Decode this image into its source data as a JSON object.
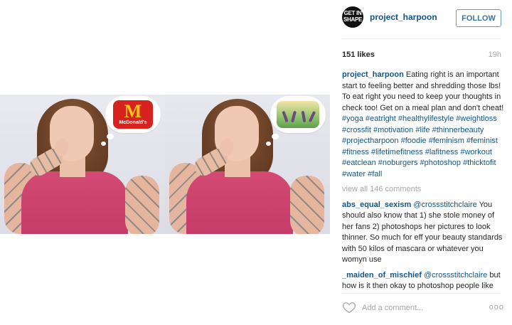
{
  "post": {
    "images": [
      {
        "thought": "McDonald's"
      },
      {
        "thought": "yoga-scene"
      }
    ],
    "header": {
      "avatar_text": "GET IN SHAPE",
      "username": "project_harpoon",
      "follow_label": "FOLLOW"
    },
    "stats": {
      "likes": "151 likes",
      "time": "19h"
    },
    "caption": {
      "username": "project_harpoon",
      "text": " Eating right is an important start to feeling better and shredding those lbs! To eat right you need to keep your thoughts in check too! Get on a meal plan and don't cheat! ",
      "hashtags": [
        "#yoga",
        "#eatright",
        "#healthylifestyle",
        "#weightloss",
        "#crossfit",
        "#motivation",
        "#life",
        "#thinnerbeauty",
        "#projectharpoon",
        "#foodie",
        "#feminism",
        "#feminist",
        "#fitness",
        "#lifetimefitness",
        "#lafitness",
        "#workout",
        "#eatclean",
        "#noburgers",
        "#photoshop",
        "#thicktofit",
        "#water",
        "#fall"
      ]
    },
    "view_all": "view all 146 comments",
    "comments": [
      {
        "username": "abs_equal_sexism",
        "mention": "@crossstitchclaire",
        "text": " You should also know that 1) she stole money of her fans 2) photoshops her pictures to look thinner. So much for eff your beauty standards with 50 kilos of mascara or whatever you womyn use"
      },
      {
        "username": "_maiden_of_mischief",
        "mention": "@crossstitchclaire",
        "text": " but how is it then okay to photoshop people like Katy Perry and Emma Watson"
      }
    ],
    "add_comment_placeholder": "Add a comment...",
    "more_label": "ooo"
  },
  "colors": {
    "link": "#125688",
    "follow_text": "#3f729b",
    "muted": "#a5a7aa",
    "dress": "#c23a66"
  },
  "icons": {
    "like": "heart-outline-icon",
    "more": "more-options-icon"
  }
}
